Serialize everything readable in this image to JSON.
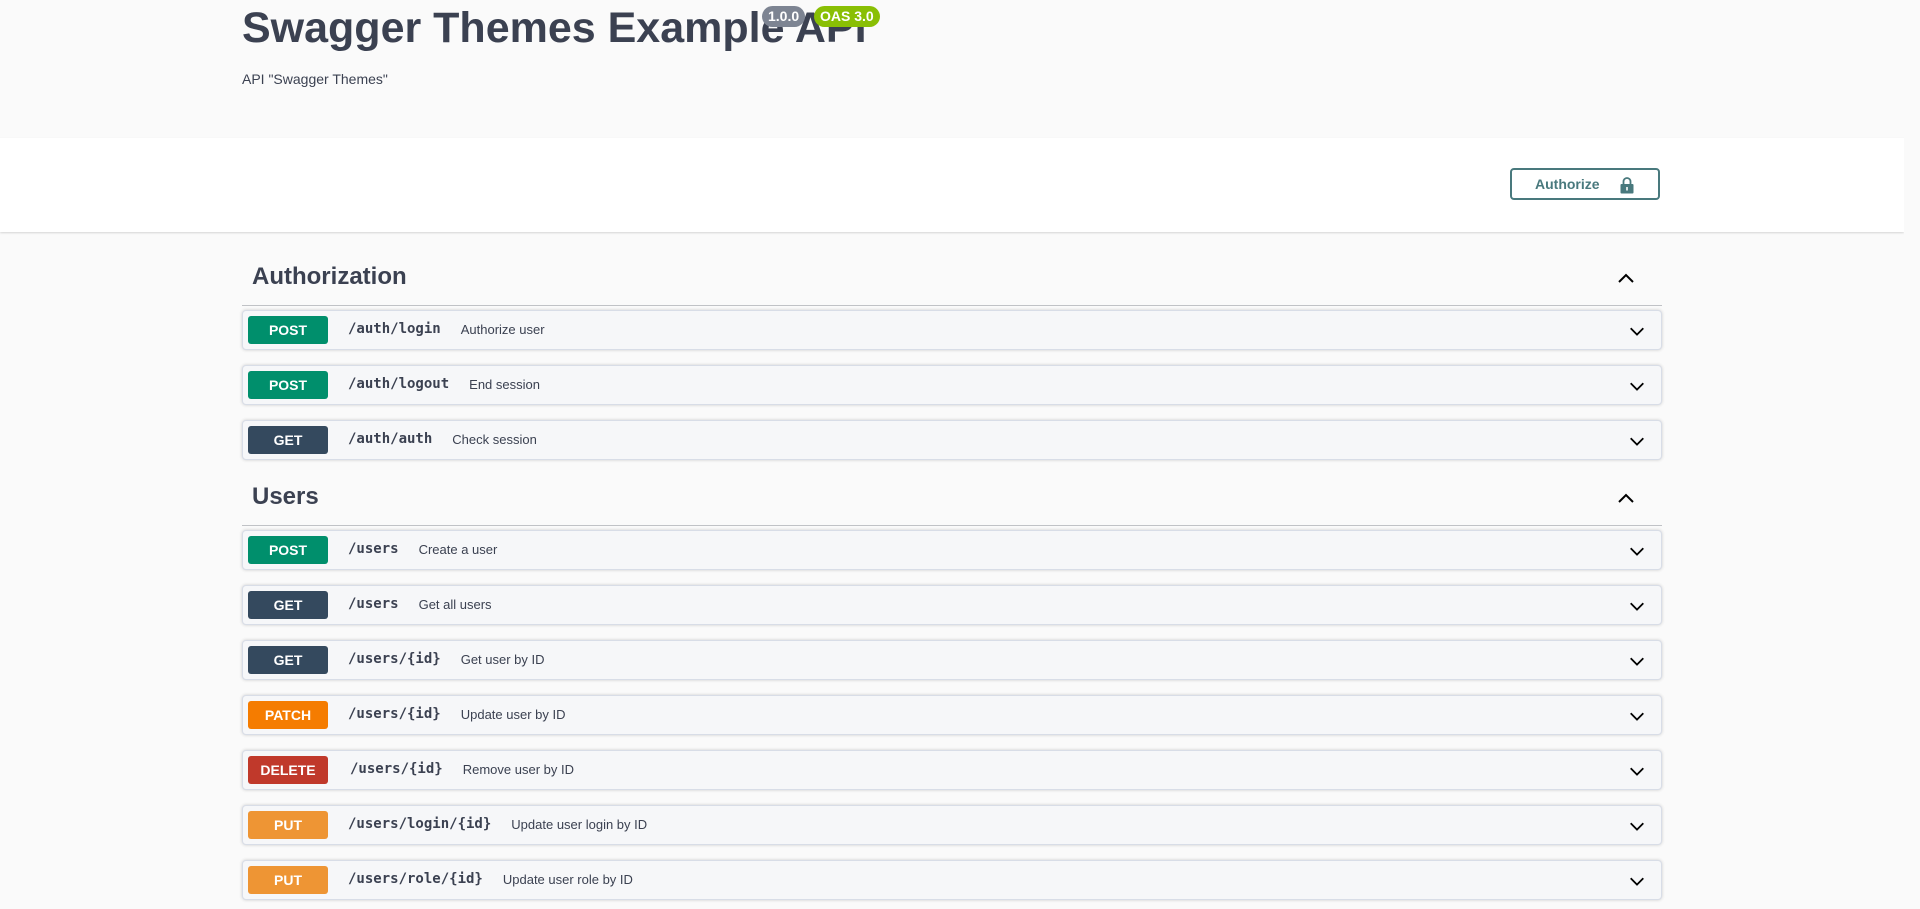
{
  "info": {
    "title": "Swagger Themes Example API",
    "version_badge": "1.0.0",
    "oas_badge": "OAS 3.0",
    "description": "API \"Swagger Themes\""
  },
  "scheme": {
    "authorize_label": "Authorize"
  },
  "colors": {
    "post": "#008f6c",
    "get": "#34495e",
    "patch": "#f57c00",
    "delete": "#c0392b",
    "put": "#ee9534",
    "authorize": "#49797d"
  },
  "tags": [
    {
      "name": "Authorization",
      "expanded": true,
      "operations": [
        {
          "method": "POST",
          "path": "/auth/login",
          "summary": "Authorize user"
        },
        {
          "method": "POST",
          "path": "/auth/logout",
          "summary": "End session"
        },
        {
          "method": "GET",
          "path": "/auth/auth",
          "summary": "Check session"
        }
      ]
    },
    {
      "name": "Users",
      "expanded": true,
      "operations": [
        {
          "method": "POST",
          "path": "/users",
          "summary": "Create a user"
        },
        {
          "method": "GET",
          "path": "/users",
          "summary": "Get all users"
        },
        {
          "method": "GET",
          "path": "/users/{id}",
          "summary": "Get user by ID"
        },
        {
          "method": "PATCH",
          "path": "/users/{id}",
          "summary": "Update user by ID"
        },
        {
          "method": "DELETE",
          "path": "/users/{id}",
          "summary": "Remove user by ID"
        },
        {
          "method": "PUT",
          "path": "/users/login/{id}",
          "summary": "Update user login by ID"
        },
        {
          "method": "PUT",
          "path": "/users/role/{id}",
          "summary": "Update user role by ID"
        }
      ]
    }
  ],
  "icons": {
    "lock": "lock-icon",
    "collapse": "chevron-up-icon",
    "expand": "chevron-down-icon"
  }
}
